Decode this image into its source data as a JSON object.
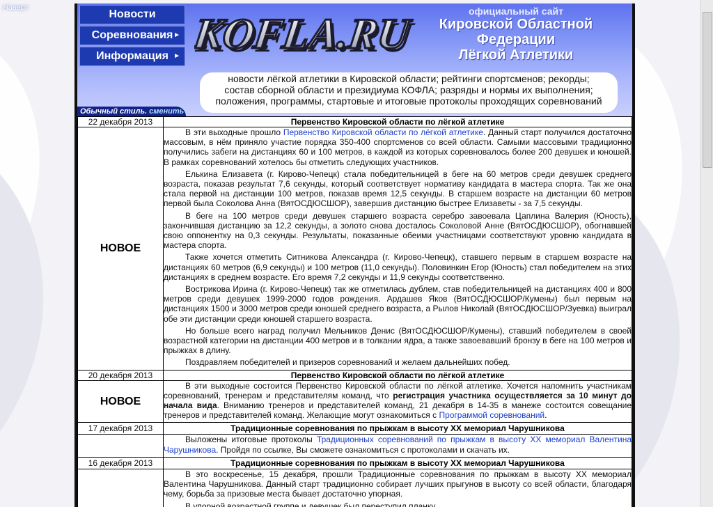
{
  "top": {
    "up_label": "Наверх"
  },
  "menu": [
    {
      "label": "Новости",
      "has_submenu": false
    },
    {
      "label": "Соревнования",
      "has_submenu": true
    },
    {
      "label": "Информация",
      "has_submenu": true
    }
  ],
  "header": {
    "logo_text": "KOFLA.RU",
    "official": "официальный сайт",
    "title_lines": [
      "Кировской Областной",
      "Федерации",
      "Лёгкой Атлетики"
    ],
    "description_lines": [
      "новости лёгкой атлетики в Кировской области; рейтинги спортсменов; рекорды;",
      "состав сборной области и президиума КОФЛА; разряды и нормы их выполнения;",
      "положения, программы, стартовые и итоговые протоколы проходящих соревнований"
    ],
    "style_label": "Обычный стиль.",
    "style_link": "сменить"
  },
  "news": [
    {
      "date": "22 декабря 2013",
      "title": "Первенство Кировской области по лёгкой атлетике",
      "badge": "НОВОЕ",
      "paragraphs": [
        {
          "parts": [
            {
              "t": "В эти выходные прошло "
            },
            {
              "t": "Первенство Кировской области по лёгкой атлетике",
              "link": true
            },
            {
              "t": ". Данный старт получился достаточно массовым, в нём приняло участие порядка 350-400 спортсменов со всей области. Самыми массовыми традиционно получились забеги на дистанциях 60 и 100 метров, в каждой из которых соревновалось более 200 девушек и юношей. В рамках соревнований хотелось бы отметить следующих участников."
            }
          ]
        },
        {
          "parts": [
            {
              "t": "Елькина Елизавета (г. Кирово-Чепецк) стала победительницей в беге на 60 метров среди девушек среднего возраста, показав результат 7,6 секунды, который соответствует нормативу кандидата в мастера спорта. Так же она стала первой на дистанции 100 метров, показав время 12,5 секунды. В старшем возрасте на дистанции 60 метров первой была Соколова Анна (ВятОСДЮСШОР), завершив дистанцию быстрее Елизаветы - за 7,5 секунды."
            }
          ]
        },
        {
          "parts": [
            {
              "t": "В беге на 100 метров среди девушек старшего возраста серебро завоевала Цаплина Валерия (Юность), закончившая дистанцию за 12,2 секунды, а золото снова досталось Соколовой Анне (ВятОСДЮСШОР), обогнавшей свою оппонентку на 0,3 секунды. Результаты, показанные обеими участницами соответствуют уровню кандидата в мастера спорта."
            }
          ]
        },
        {
          "parts": [
            {
              "t": "Также хочется отметить Ситникова Александра (г. Кирово-Чепецк), ставшего первым в старшем возрасте на дистанциях 60 метров (6,9 секунды) и 100 метров (11,0 секунды). Половинкин Егор (Юность) стал победителем на этих дистанциях в среднем возрасте. Его время 7,2 секунды и 11,9 секунды соответственно."
            }
          ]
        },
        {
          "parts": [
            {
              "t": "Вострикова Ирина (г. Кирово-Чепецк) так же отметилась дублем, став победительницей на дистанциях 400 и 800 метров среди девушек 1999-2000 годов рождения. Ардашев Яков (ВятОСДЮСШОР/Кумены) был первым на дистанциях 1500 и 3000 метров среди юношей среднего возраста, а Рылов Николай (ВятОСДЮСШОР/Зуевка) выиграл обе эти дистанции среди юношей старшего возраста."
            }
          ]
        },
        {
          "parts": [
            {
              "t": "Но больше всего наград получил Мельников Денис (ВятОСДЮСШОР/Кумены), ставший победителем в своей возрастной категории на дистанции 400 метров и в толкании ядра, а также завоевавший бронзу в беге на 100 метров и прыжках в длину."
            }
          ]
        },
        {
          "parts": [
            {
              "t": "Поздравляем победителей и призеров соревнований и желаем дальнейших побед."
            }
          ]
        }
      ]
    },
    {
      "date": "20 декабря 2013",
      "title": "Первенство Кировской области по лёгкой атлетике",
      "badge": "НОВОЕ",
      "paragraphs": [
        {
          "parts": [
            {
              "t": "В эти выходные состоится Первенство Кировской области по лёгкой атлетике. Хочется напомнить участникам соревнований, тренерам и представителям команд, что "
            },
            {
              "t": "регистрация участника осуществляется за 10 минут до начала вида",
              "bold": true
            },
            {
              "t": ". Вниманию тренеров и представителей команд, 21 декабря в 14-35 в манеже состоится совещание тренеров и представителей команд. Желающие могут ознакомиться с "
            },
            {
              "t": "Программой соревнований",
              "link": true
            },
            {
              "t": "."
            }
          ]
        }
      ]
    },
    {
      "date": "17 декабря 2013",
      "title": "Традиционные соревнования по прыжкам в высоту XX мемориал Чарушникова",
      "badge": "",
      "paragraphs": [
        {
          "parts": [
            {
              "t": "Выложены итоговые протоколы "
            },
            {
              "t": "Традиционных соревнований по прыжкам в высоту XX мемориал Валентина Чарушникова",
              "link": true
            },
            {
              "t": ". Пройдя по ссылке, Вы сможете ознакомиться с протоколами и скачать их."
            }
          ]
        }
      ]
    },
    {
      "date": "16 декабря 2013",
      "title": "Традиционные соревнования по прыжкам в высоту XX мемориал Чарушникова",
      "badge": "",
      "paragraphs": [
        {
          "parts": [
            {
              "t": "В это воскресенье, 15 декабря, прошли Традиционные соревнования по прыжкам в высоту XX мемориал Валентина Чарушникова. Данный старт традиционно собирает лучших прыгунов в высоту со всей области, благодаря чему, борьба за призовые места бывает достаточно упорная."
            }
          ]
        },
        {
          "parts": [
            {
              "t": "В упорной возрастной группе и девушек был переступил планку..."
            }
          ]
        }
      ]
    }
  ]
}
